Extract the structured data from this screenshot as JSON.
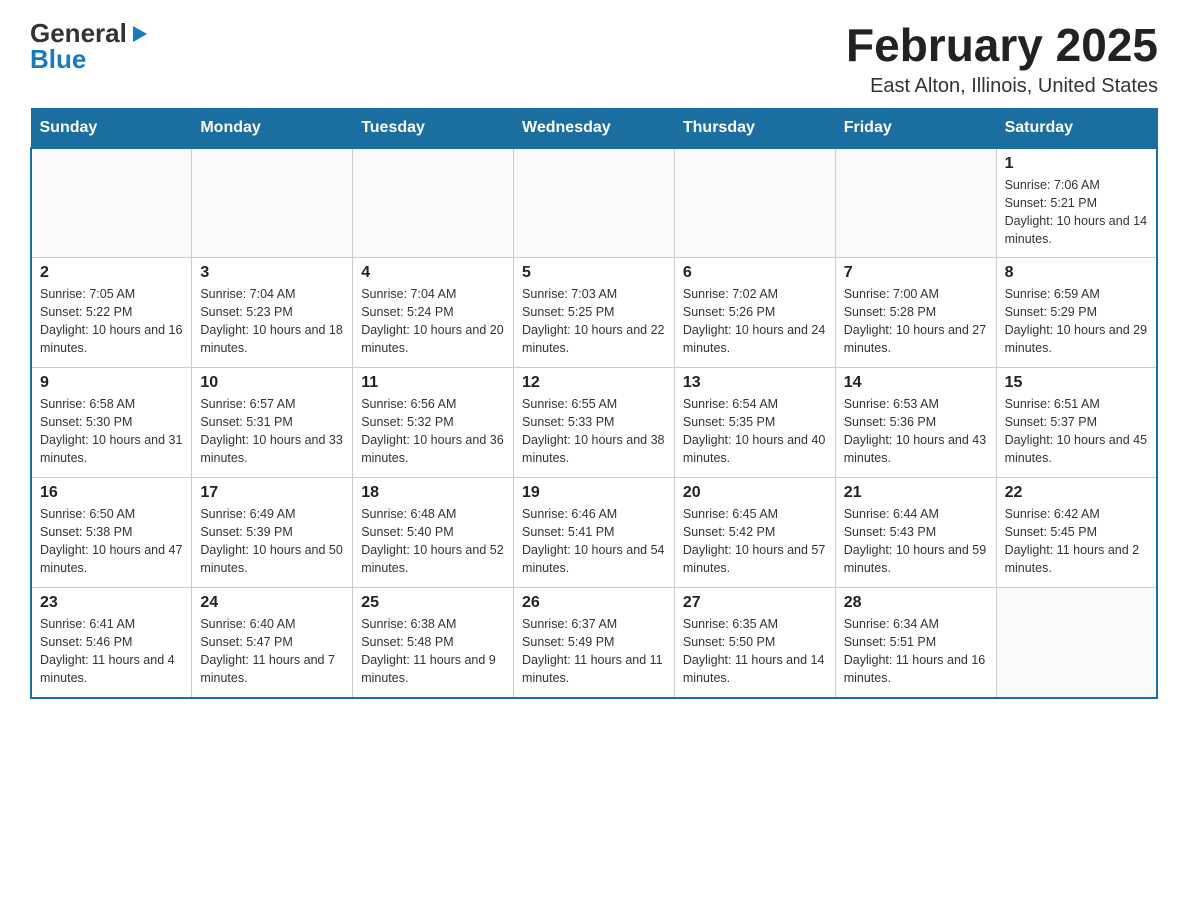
{
  "logo": {
    "general": "General",
    "blue": "Blue",
    "arrow": "▶"
  },
  "title": "February 2025",
  "location": "East Alton, Illinois, United States",
  "days_of_week": [
    "Sunday",
    "Monday",
    "Tuesday",
    "Wednesday",
    "Thursday",
    "Friday",
    "Saturday"
  ],
  "weeks": [
    [
      {
        "day": "",
        "info": ""
      },
      {
        "day": "",
        "info": ""
      },
      {
        "day": "",
        "info": ""
      },
      {
        "day": "",
        "info": ""
      },
      {
        "day": "",
        "info": ""
      },
      {
        "day": "",
        "info": ""
      },
      {
        "day": "1",
        "info": "Sunrise: 7:06 AM\nSunset: 5:21 PM\nDaylight: 10 hours and 14 minutes."
      }
    ],
    [
      {
        "day": "2",
        "info": "Sunrise: 7:05 AM\nSunset: 5:22 PM\nDaylight: 10 hours and 16 minutes."
      },
      {
        "day": "3",
        "info": "Sunrise: 7:04 AM\nSunset: 5:23 PM\nDaylight: 10 hours and 18 minutes."
      },
      {
        "day": "4",
        "info": "Sunrise: 7:04 AM\nSunset: 5:24 PM\nDaylight: 10 hours and 20 minutes."
      },
      {
        "day": "5",
        "info": "Sunrise: 7:03 AM\nSunset: 5:25 PM\nDaylight: 10 hours and 22 minutes."
      },
      {
        "day": "6",
        "info": "Sunrise: 7:02 AM\nSunset: 5:26 PM\nDaylight: 10 hours and 24 minutes."
      },
      {
        "day": "7",
        "info": "Sunrise: 7:00 AM\nSunset: 5:28 PM\nDaylight: 10 hours and 27 minutes."
      },
      {
        "day": "8",
        "info": "Sunrise: 6:59 AM\nSunset: 5:29 PM\nDaylight: 10 hours and 29 minutes."
      }
    ],
    [
      {
        "day": "9",
        "info": "Sunrise: 6:58 AM\nSunset: 5:30 PM\nDaylight: 10 hours and 31 minutes."
      },
      {
        "day": "10",
        "info": "Sunrise: 6:57 AM\nSunset: 5:31 PM\nDaylight: 10 hours and 33 minutes."
      },
      {
        "day": "11",
        "info": "Sunrise: 6:56 AM\nSunset: 5:32 PM\nDaylight: 10 hours and 36 minutes."
      },
      {
        "day": "12",
        "info": "Sunrise: 6:55 AM\nSunset: 5:33 PM\nDaylight: 10 hours and 38 minutes."
      },
      {
        "day": "13",
        "info": "Sunrise: 6:54 AM\nSunset: 5:35 PM\nDaylight: 10 hours and 40 minutes."
      },
      {
        "day": "14",
        "info": "Sunrise: 6:53 AM\nSunset: 5:36 PM\nDaylight: 10 hours and 43 minutes."
      },
      {
        "day": "15",
        "info": "Sunrise: 6:51 AM\nSunset: 5:37 PM\nDaylight: 10 hours and 45 minutes."
      }
    ],
    [
      {
        "day": "16",
        "info": "Sunrise: 6:50 AM\nSunset: 5:38 PM\nDaylight: 10 hours and 47 minutes."
      },
      {
        "day": "17",
        "info": "Sunrise: 6:49 AM\nSunset: 5:39 PM\nDaylight: 10 hours and 50 minutes."
      },
      {
        "day": "18",
        "info": "Sunrise: 6:48 AM\nSunset: 5:40 PM\nDaylight: 10 hours and 52 minutes."
      },
      {
        "day": "19",
        "info": "Sunrise: 6:46 AM\nSunset: 5:41 PM\nDaylight: 10 hours and 54 minutes."
      },
      {
        "day": "20",
        "info": "Sunrise: 6:45 AM\nSunset: 5:42 PM\nDaylight: 10 hours and 57 minutes."
      },
      {
        "day": "21",
        "info": "Sunrise: 6:44 AM\nSunset: 5:43 PM\nDaylight: 10 hours and 59 minutes."
      },
      {
        "day": "22",
        "info": "Sunrise: 6:42 AM\nSunset: 5:45 PM\nDaylight: 11 hours and 2 minutes."
      }
    ],
    [
      {
        "day": "23",
        "info": "Sunrise: 6:41 AM\nSunset: 5:46 PM\nDaylight: 11 hours and 4 minutes."
      },
      {
        "day": "24",
        "info": "Sunrise: 6:40 AM\nSunset: 5:47 PM\nDaylight: 11 hours and 7 minutes."
      },
      {
        "day": "25",
        "info": "Sunrise: 6:38 AM\nSunset: 5:48 PM\nDaylight: 11 hours and 9 minutes."
      },
      {
        "day": "26",
        "info": "Sunrise: 6:37 AM\nSunset: 5:49 PM\nDaylight: 11 hours and 11 minutes."
      },
      {
        "day": "27",
        "info": "Sunrise: 6:35 AM\nSunset: 5:50 PM\nDaylight: 11 hours and 14 minutes."
      },
      {
        "day": "28",
        "info": "Sunrise: 6:34 AM\nSunset: 5:51 PM\nDaylight: 11 hours and 16 minutes."
      },
      {
        "day": "",
        "info": ""
      }
    ]
  ]
}
